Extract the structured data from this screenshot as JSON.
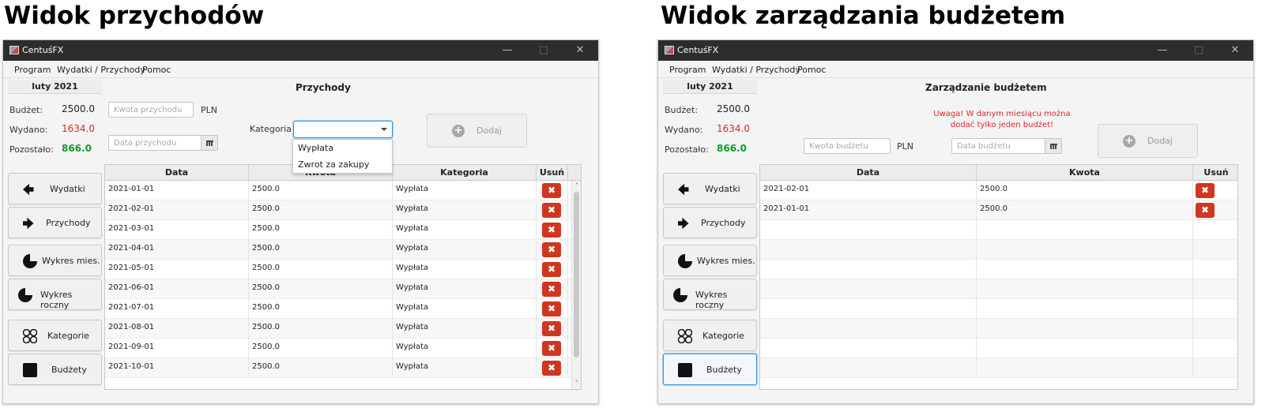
{
  "left": {
    "heading": "Widok przychodów",
    "window": {
      "title": "CentuśFX",
      "menu": [
        "Program",
        "Wydatki / Przychody",
        "Pomoc"
      ],
      "month": "luty 2021",
      "summary": {
        "budget_label": "Budżet:",
        "budget_value": "2500.0",
        "spent_label": "Wydano:",
        "spent_value": "1634.0",
        "remaining_label": "Pozostało:",
        "remaining_value": "866.0"
      },
      "view_title": "Przychody",
      "amount_placeholder": "Kwota przychodu",
      "currency": "PLN",
      "date_placeholder": "Data przychodu",
      "category_label": "Kategoria:",
      "dropdown_options": [
        "Wypłata",
        "Zwrot za zakupy"
      ],
      "add_button": "Dodaj",
      "sidebar": [
        "Wydatki",
        "Przychody",
        "Wykres mies.",
        "Wykres roczny",
        "Kategorie",
        "Budżety"
      ],
      "table": {
        "columns": [
          "Data",
          "Kwota",
          "Kategoria",
          "Usuń"
        ],
        "rows": [
          [
            "2021-01-01",
            "2500.0",
            "Wypłata"
          ],
          [
            "2021-02-01",
            "2500.0",
            "Wypłata"
          ],
          [
            "2021-03-01",
            "2500.0",
            "Wypłata"
          ],
          [
            "2021-04-01",
            "2500.0",
            "Wypłata"
          ],
          [
            "2021-05-01",
            "2500.0",
            "Wypłata"
          ],
          [
            "2021-06-01",
            "2500.0",
            "Wypłata"
          ],
          [
            "2021-07-01",
            "2500.0",
            "Wypłata"
          ],
          [
            "2021-08-01",
            "2500.0",
            "Wypłata"
          ],
          [
            "2021-09-01",
            "2500.0",
            "Wypłata"
          ],
          [
            "2021-10-01",
            "2500.0",
            "Wypłata"
          ]
        ]
      }
    }
  },
  "right": {
    "heading": "Widok zarządzania budżetem",
    "window": {
      "title": "CentuśFX",
      "menu": [
        "Program",
        "Wydatki / Przychody",
        "Pomoc"
      ],
      "month": "luty 2021",
      "summary": {
        "budget_label": "Budżet:",
        "budget_value": "2500.0",
        "spent_label": "Wydano:",
        "spent_value": "1634.0",
        "remaining_label": "Pozostało:",
        "remaining_value": "866.0"
      },
      "view_title": "Zarządzanie budżetem",
      "warning_line1": "Uwaga! W danym miesiącu można",
      "warning_line2": "dodać tylko jeden budżet!",
      "amount_placeholder": "Kwota budżetu",
      "currency": "PLN",
      "date_placeholder": "Data budżetu",
      "add_button": "Dodaj",
      "sidebar": [
        "Wydatki",
        "Przychody",
        "Wykres mies.",
        "Wykres roczny",
        "Kategorie",
        "Budżety"
      ],
      "table": {
        "columns": [
          "Data",
          "Kwota",
          "Usuń"
        ],
        "rows": [
          [
            "2021-02-01",
            "2500.0"
          ],
          [
            "2021-01-01",
            "2500.0"
          ]
        ]
      }
    }
  },
  "colors": {
    "accent": "#3a93d6",
    "delete": "#d0361f",
    "spent": "#e0262b",
    "remaining": "#0f9a2e",
    "titlebar": "#2d2d2d"
  }
}
